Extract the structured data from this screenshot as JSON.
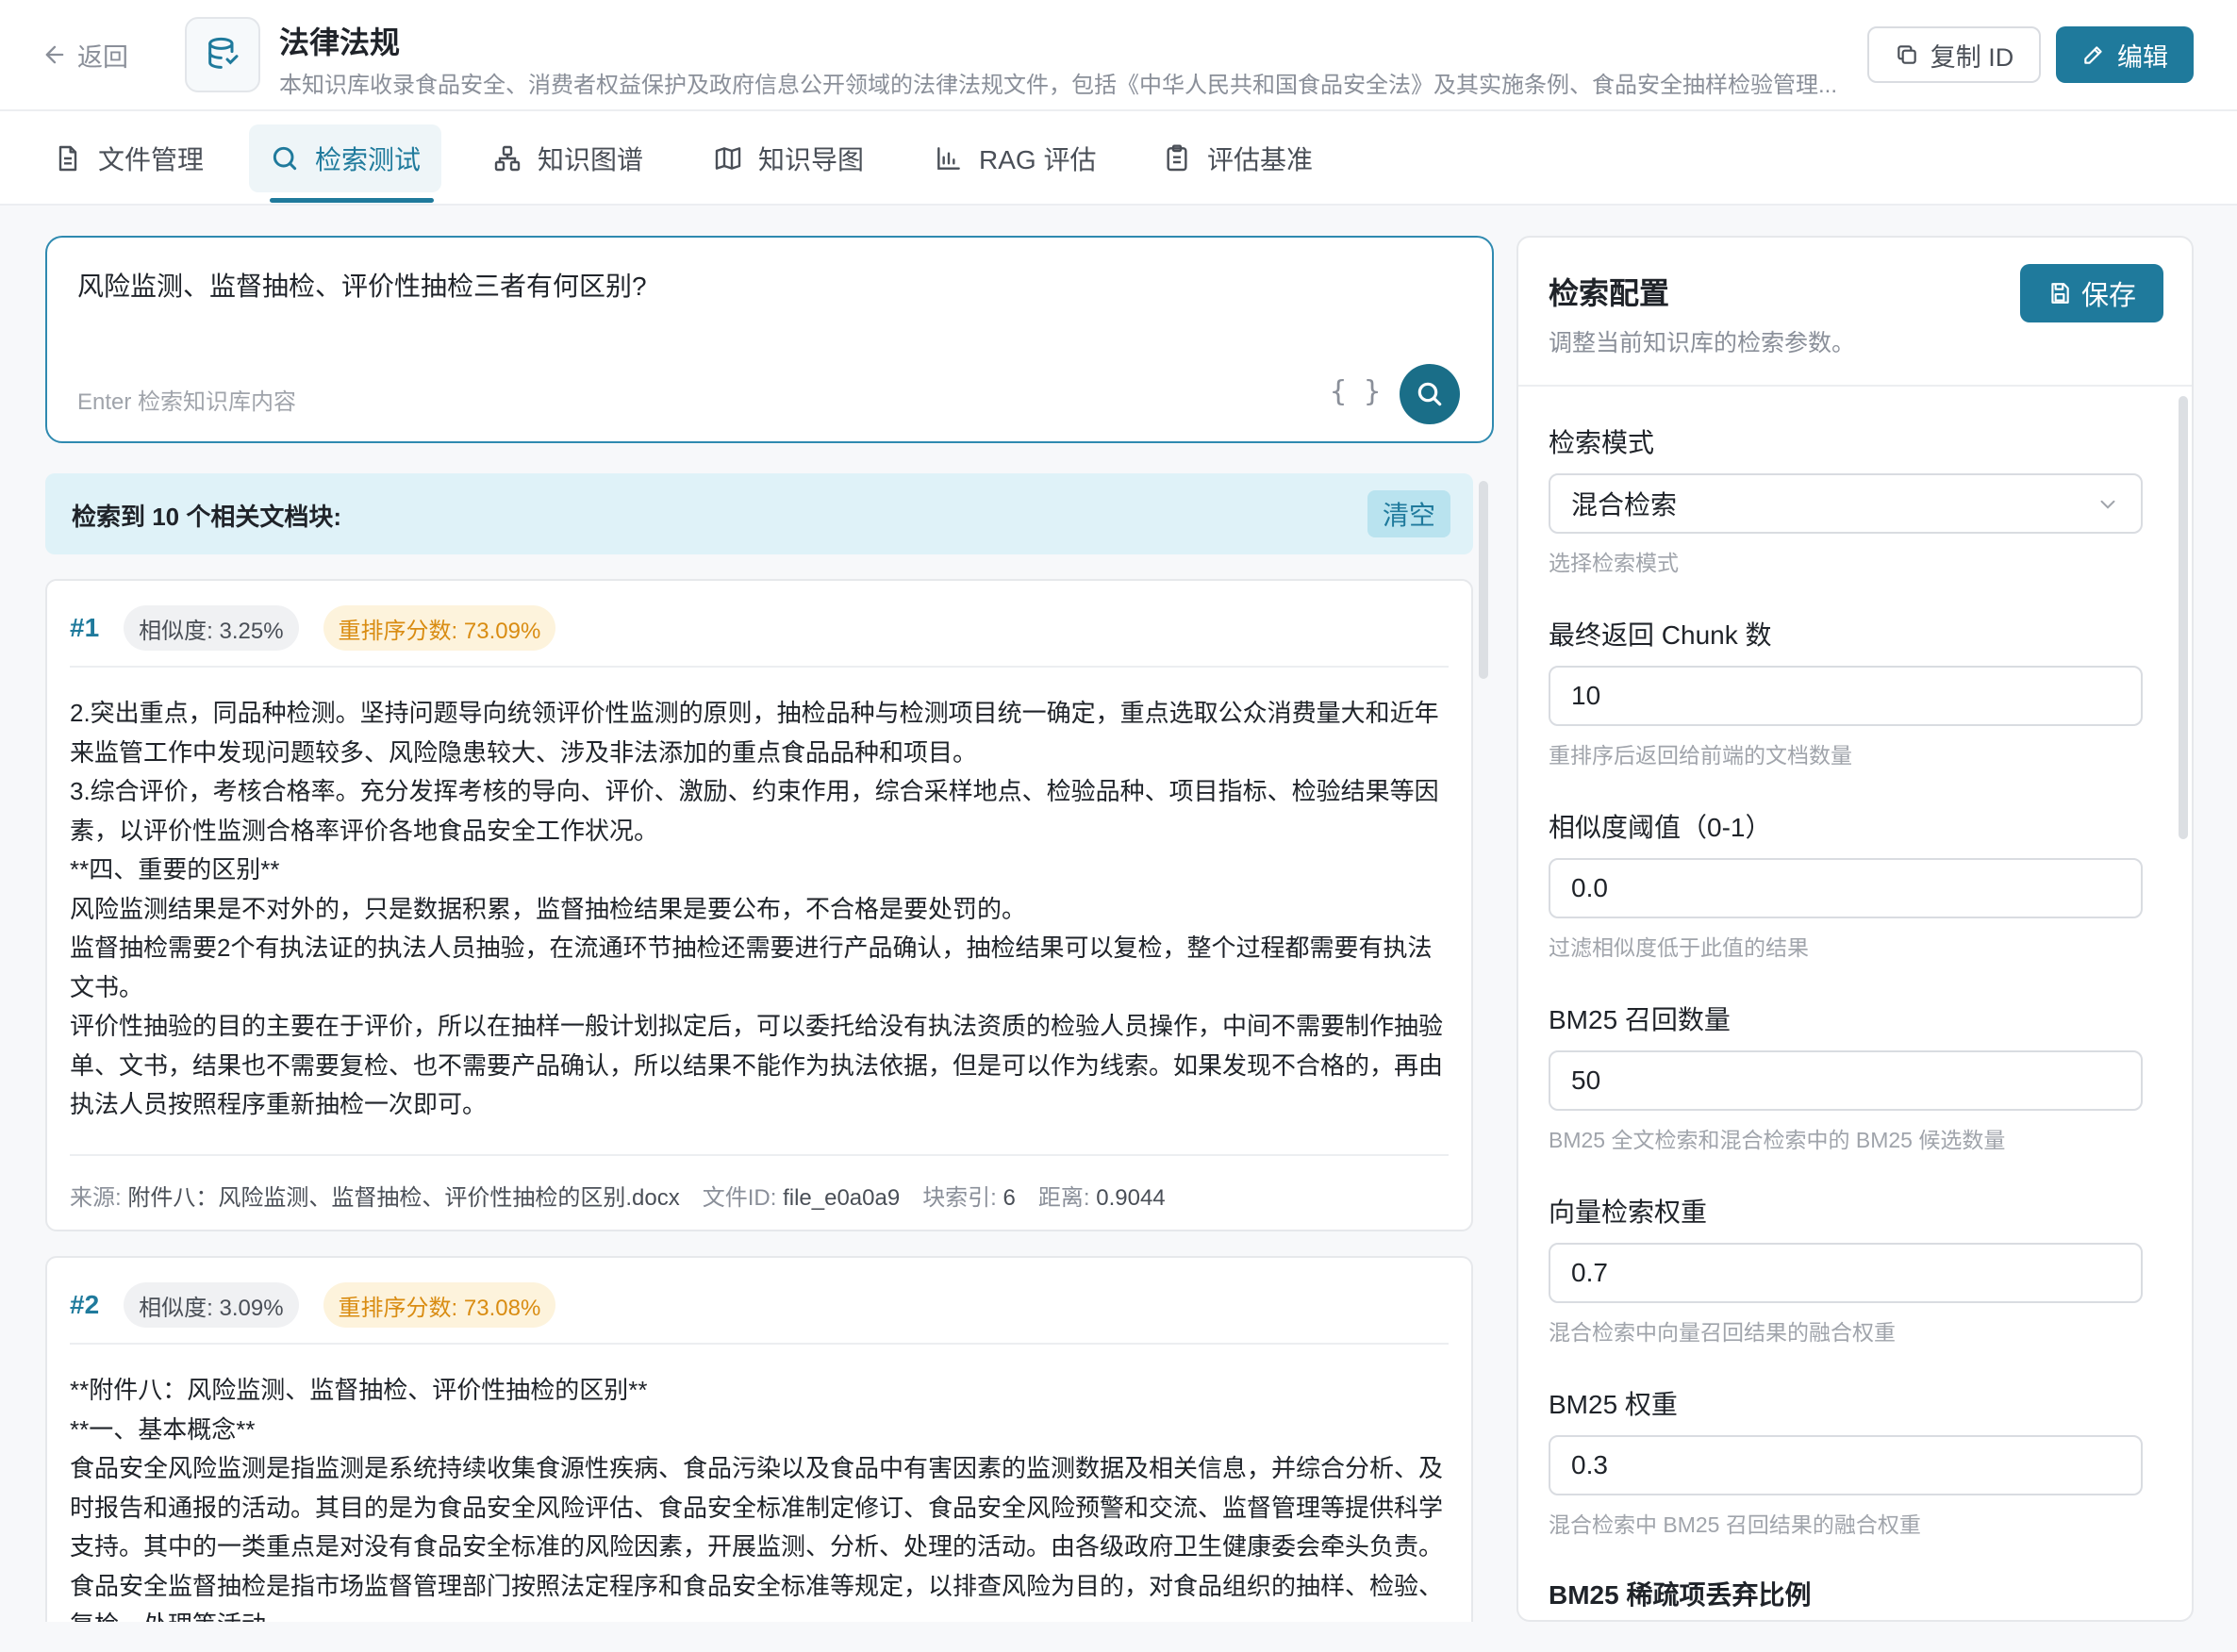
{
  "header": {
    "back_label": "返回",
    "title": "法律法规",
    "description": "本知识库收录食品安全、消费者权益保护及政府信息公开领域的法律法规文件，包括《中华人民共和国食品安全法》及其实施条例、食品安全抽样检验管理...",
    "copy_id_label": "复制 ID",
    "edit_label": "编辑"
  },
  "tabs": [
    {
      "label": "文件管理",
      "icon": "document-icon"
    },
    {
      "label": "检索测试",
      "icon": "search-icon",
      "active": true
    },
    {
      "label": "知识图谱",
      "icon": "graph-icon"
    },
    {
      "label": "知识导图",
      "icon": "map-icon"
    },
    {
      "label": "RAG 评估",
      "icon": "bar-chart-icon"
    },
    {
      "label": "评估基准",
      "icon": "clipboard-icon"
    }
  ],
  "query": {
    "text": "风险监测、监督抽检、评价性抽检三者有何区别?",
    "placeholder": "Enter 检索知识库内容",
    "braces": "{ }"
  },
  "results": {
    "summary": "检索到 10 个相关文档块:",
    "clear_label": "清空",
    "items": [
      {
        "num": "#1",
        "similarity": "相似度: 3.25%",
        "rerank": "重排序分数: 73.09%",
        "lines": [
          "2.突出重点，同品种检测。坚持问题导向统领评价性监测的原则，抽检品种与检测项目统一确定，重点选取公众消费量大和近年来监管工作中发现问题较多、风险隐患较大、涉及非法添加的重点食品品种和项目。",
          "3.综合评价，考核合格率。充分发挥考核的导向、评价、激励、约束作用，综合采样地点、检验品种、项目指标、检验结果等因素，以评价性监测合格率评价各地食品安全工作状况。",
          "**四、重要的区别**",
          "风险监测结果是不对外的，只是数据积累，监督抽检结果是要公布，不合格是要处罚的。",
          "监督抽检需要2个有执法证的执法人员抽验，在流通环节抽检还需要进行产品确认，抽检结果可以复检，整个过程都需要有执法文书。",
          "评价性抽验的目的主要在于评价，所以在抽样一般计划拟定后，可以委托给没有执法资质的检验人员操作，中间不需要制作抽验单、文书，结果也不需要复检、也不需要产品确认，所以结果不能作为执法依据，但是可以作为线索。如果发现不合格的，再由执法人员按照程序重新抽检一次即可。"
        ],
        "meta": {
          "source_label": "来源:",
          "source": "附件八：风险监测、监督抽检、评价性抽检的区别.docx",
          "file_label": "文件ID:",
          "file_id": "file_e0a0a9",
          "chunk_label": "块索引:",
          "chunk": "6",
          "dist_label": "距离:",
          "distance": "0.9044"
        }
      },
      {
        "num": "#2",
        "similarity": "相似度: 3.09%",
        "rerank": "重排序分数: 73.08%",
        "lines": [
          "**附件八：风险监测、监督抽检、评价性抽检的区别**",
          "**一、基本概念**",
          "食品安全风险监测是指监测是系统持续收集食源性疾病、食品污染以及食品中有害因素的监测数据及相关信息，并综合分析、及时报告和通报的活动。其目的是为食品安全风险评估、食品安全标准制定修订、食品安全风险预警和交流、监督管理等提供科学支持。其中的一类重点是对没有食品安全标准的风险因素，开展监测、分析、处理的活动。由各级政府卫生健康委会牵头负责。",
          "食品安全监督抽检是指市场监督管理部门按照法定程序和食品安全标准等规定，以排查风险为目的，对食品组织的抽样、检验、复检、处理等活动。"
        ]
      }
    ]
  },
  "config": {
    "title": "检索配置",
    "subtitle": "调整当前知识库的检索参数。",
    "save_label": "保存",
    "fields": [
      {
        "label": "检索模式",
        "value": "混合检索",
        "hint": "选择检索模式",
        "type": "select"
      },
      {
        "label": "最终返回 Chunk 数",
        "value": "10",
        "hint": "重排序后返回给前端的文档数量"
      },
      {
        "label": "相似度阈值（0-1）",
        "value": "0.0",
        "hint": "过滤相似度低于此值的结果"
      },
      {
        "label": "BM25 召回数量",
        "value": "50",
        "hint": "BM25 全文检索和混合检索中的 BM25 候选数量"
      },
      {
        "label": "向量检索权重",
        "value": "0.7",
        "hint": "混合检索中向量召回结果的融合权重"
      },
      {
        "label": "BM25 权重",
        "value": "0.3",
        "hint": "混合检索中 BM25 召回结果的融合权重"
      },
      {
        "label": "BM25 稀疏项丢弃比例",
        "value": "",
        "hint": ""
      }
    ]
  },
  "colors": {
    "accent": "#1f7a9c",
    "rerank": "#d98c12",
    "banner_bg": "#dff2f8"
  }
}
